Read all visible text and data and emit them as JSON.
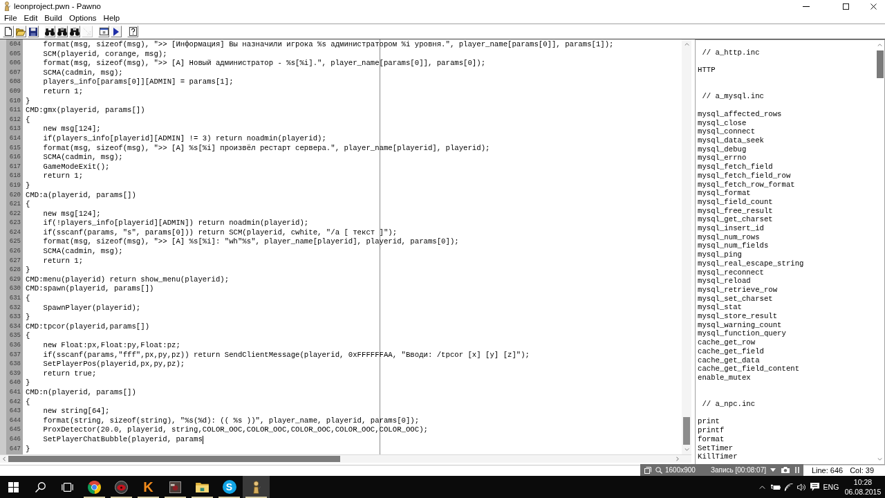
{
  "window": {
    "title": "leonproject.pwn - Pawno"
  },
  "menu": [
    "File",
    "Edit",
    "Build",
    "Options",
    "Help"
  ],
  "toolbar": [
    {
      "buttons": [
        {
          "kind": "new",
          "disabled": false
        },
        {
          "kind": "open",
          "disabled": false
        },
        {
          "kind": "save",
          "disabled": false
        }
      ]
    },
    {
      "buttons": [
        {
          "kind": "find",
          "disabled": false
        },
        {
          "kind": "find-next",
          "disabled": false
        },
        {
          "kind": "replace",
          "disabled": false
        },
        {
          "kind": "goto",
          "disabled": true
        }
      ]
    },
    {
      "buttons": [
        {
          "kind": "window",
          "disabled": false
        },
        {
          "kind": "run",
          "disabled": false
        }
      ]
    },
    {
      "buttons": [
        {
          "kind": "help",
          "disabled": false
        }
      ]
    }
  ],
  "editor": {
    "lines": [
      {
        "number": "604",
        "code": "    format(msg, sizeof(msg), \">> [Информация] Вы назначили игрока %s администратором %i уровня.\", player_name[params[0]], params[1]);",
        "cursor": false
      },
      {
        "number": "605",
        "code": "    SCM(playerid, corange, msg);",
        "cursor": false
      },
      {
        "number": "606",
        "code": "    format(msg, sizeof(msg), \">> [A] Новый администратор - %s[%i].\", player_name[params[0]], params[0]);",
        "cursor": false
      },
      {
        "number": "607",
        "code": "    SCMA(cadmin, msg);",
        "cursor": false
      },
      {
        "number": "608",
        "code": "    players_info[params[0]][ADMIN] = params[1];",
        "cursor": false
      },
      {
        "number": "609",
        "code": "    return 1;",
        "cursor": false
      },
      {
        "number": "610",
        "code": "}",
        "cursor": false
      },
      {
        "number": "611",
        "code": "CMD:gmx(playerid, params[])",
        "cursor": false
      },
      {
        "number": "612",
        "code": "{",
        "cursor": false
      },
      {
        "number": "613",
        "code": "    new msg[124];",
        "cursor": false
      },
      {
        "number": "614",
        "code": "    if(players_info[playerid][ADMIN] != 3) return noadmin(playerid);",
        "cursor": false
      },
      {
        "number": "615",
        "code": "    format(msg, sizeof(msg), \">> [A] %s[%i] произвёл рестарт сервера.\", player_name[playerid], playerid);",
        "cursor": false
      },
      {
        "number": "616",
        "code": "    SCMA(cadmin, msg);",
        "cursor": false
      },
      {
        "number": "617",
        "code": "    GameModeExit();",
        "cursor": false
      },
      {
        "number": "618",
        "code": "    return 1;",
        "cursor": false
      },
      {
        "number": "619",
        "code": "}",
        "cursor": false
      },
      {
        "number": "620",
        "code": "CMD:a(playerid, params[])",
        "cursor": false
      },
      {
        "number": "621",
        "code": "{",
        "cursor": false
      },
      {
        "number": "622",
        "code": "    new msg[124];",
        "cursor": false
      },
      {
        "number": "623",
        "code": "    if(!players_info[playerid][ADMIN]) return noadmin(playerid);",
        "cursor": false
      },
      {
        "number": "624",
        "code": "    if(sscanf(params, \"s\", params[0])) return SCM(playerid, cwhite, \"/a [ текст ]\");",
        "cursor": false
      },
      {
        "number": "625",
        "code": "    format(msg, sizeof(msg), \">> [A] %s[%i]: \"wh\"%s\", player_name[playerid], playerid, params[0]);",
        "cursor": false
      },
      {
        "number": "626",
        "code": "    SCMA(cadmin, msg);",
        "cursor": false
      },
      {
        "number": "627",
        "code": "    return 1;",
        "cursor": false
      },
      {
        "number": "628",
        "code": "}",
        "cursor": false
      },
      {
        "number": "629",
        "code": "CMD:menu(playerid) return show_menu(playerid);",
        "cursor": false
      },
      {
        "number": "630",
        "code": "CMD:spawn(playerid, params[])",
        "cursor": false
      },
      {
        "number": "631",
        "code": "{",
        "cursor": false
      },
      {
        "number": "632",
        "code": "    SpawnPlayer(playerid);",
        "cursor": false
      },
      {
        "number": "633",
        "code": "}",
        "cursor": false
      },
      {
        "number": "634",
        "code": "CMD:tpcor(playerid,params[])",
        "cursor": false
      },
      {
        "number": "635",
        "code": "{",
        "cursor": false
      },
      {
        "number": "636",
        "code": "    new Float:px,Float:py,Float:pz;",
        "cursor": false
      },
      {
        "number": "637",
        "code": "    if(sscanf(params,\"fff\",px,py,pz)) return SendClientMessage(playerid, 0xFFFFFFAA, \"Вводи: /tpcor [x] [y] [z]\");",
        "cursor": false
      },
      {
        "number": "638",
        "code": "    SetPlayerPos(playerid,px,py,pz);",
        "cursor": false
      },
      {
        "number": "639",
        "code": "    return true;",
        "cursor": false
      },
      {
        "number": "640",
        "code": "}",
        "cursor": false
      },
      {
        "number": "641",
        "code": "CMD:n(playerid, params[])",
        "cursor": false
      },
      {
        "number": "642",
        "code": "{",
        "cursor": false
      },
      {
        "number": "643",
        "code": "    new string[64];",
        "cursor": false
      },
      {
        "number": "644",
        "code": "    format(string, sizeof(string), \"%s(%d): (( %s ))\", player_name, playerid, params[0]);",
        "cursor": false
      },
      {
        "number": "645",
        "code": "    ProxDetector(20.0, playerid, string,COLOR_OOC,COLOR_OOC,COLOR_OOC,COLOR_OOC,COLOR_OOC);",
        "cursor": false
      },
      {
        "number": "646",
        "code": "    SetPlayerChatBubble(playerid, params",
        "cursor": true
      },
      {
        "number": "647",
        "code": "}",
        "cursor": false
      }
    ]
  },
  "function_list": {
    "groups": [
      {
        "header": "// a_http.inc",
        "functions": [
          "HTTP"
        ]
      },
      {
        "header": "// a_mysql.inc",
        "functions": [
          "mysql_affected_rows",
          "mysql_close",
          "mysql_connect",
          "mysql_data_seek",
          "mysql_debug",
          "mysql_errno",
          "mysql_fetch_field",
          "mysql_fetch_field_row",
          "mysql_fetch_row_format",
          "mysql_format",
          "mysql_field_count",
          "mysql_free_result",
          "mysql_get_charset",
          "mysql_insert_id",
          "mysql_num_rows",
          "mysql_num_fields",
          "mysql_ping",
          "mysql_real_escape_string",
          "mysql_reconnect",
          "mysql_reload",
          "mysql_retrieve_row",
          "mysql_set_charset",
          "mysql_stat",
          "mysql_store_result",
          "mysql_warning_count",
          "mysql_function_query",
          "cache_get_row",
          "cache_get_field",
          "cache_get_data",
          "cache_get_field_content",
          "enable_mutex"
        ]
      },
      {
        "header": "// a_npc.inc",
        "functions": [
          "print",
          "printf",
          "format",
          "SetTimer",
          "KillTimer"
        ]
      }
    ]
  },
  "recorder_bar": {
    "resolution": "1600x900",
    "status": "Запись [00:08:07]"
  },
  "status_bar": {
    "line": "Line: 646",
    "column": "Col: 39"
  },
  "taskbar": {
    "buttons": [
      {
        "kind": "start"
      },
      {
        "kind": "search"
      },
      {
        "kind": "task-view"
      }
    ],
    "apps": [
      {
        "kind": "browser",
        "running": true,
        "selected": false
      },
      {
        "kind": "record",
        "running": true,
        "selected": false
      },
      {
        "kind": "letter",
        "label": "K",
        "running": true,
        "selected": false
      },
      {
        "kind": "picture",
        "running": true,
        "selected": false
      },
      {
        "kind": "folder",
        "running": true,
        "selected": false
      },
      {
        "kind": "letter-disc",
        "label": "S",
        "running": true,
        "selected": false
      },
      {
        "kind": "figure",
        "running": true,
        "selected": true
      }
    ],
    "tray": {
      "language": "ENG",
      "time": "10:28",
      "date": "06.08.2015"
    }
  }
}
